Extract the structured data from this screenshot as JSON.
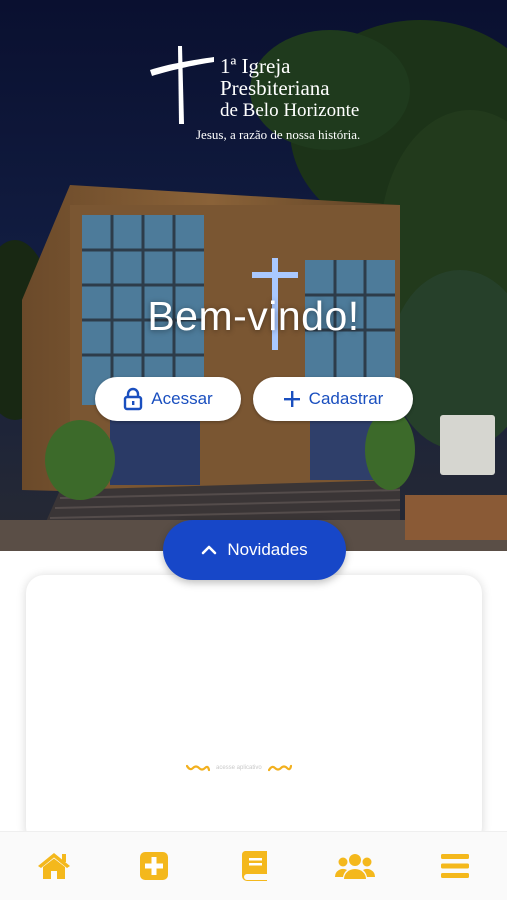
{
  "header": {
    "logo_line1": "1ª Igreja",
    "logo_line2": "Presbiteriana",
    "logo_line3": "de Belo Horizonte",
    "tagline": "Jesus, a razão de nossa história."
  },
  "hero": {
    "welcome": "Bem-vindo!"
  },
  "actions": {
    "login_label": "Acessar",
    "signup_label": "Cadastrar"
  },
  "news": {
    "toggle_label": "Novidades",
    "loader_text": "acesse aplicativo"
  },
  "bottom_nav": {
    "items": [
      {
        "icon": "home-icon"
      },
      {
        "icon": "plus-square-icon"
      },
      {
        "icon": "book-icon"
      },
      {
        "icon": "users-icon"
      },
      {
        "icon": "menu-icon"
      }
    ]
  },
  "colors": {
    "primary_blue": "#1747c8",
    "button_text_blue": "#1a4fbf",
    "nav_icon_yellow": "#f4b81c",
    "loader_yellow": "#f2b01e"
  }
}
